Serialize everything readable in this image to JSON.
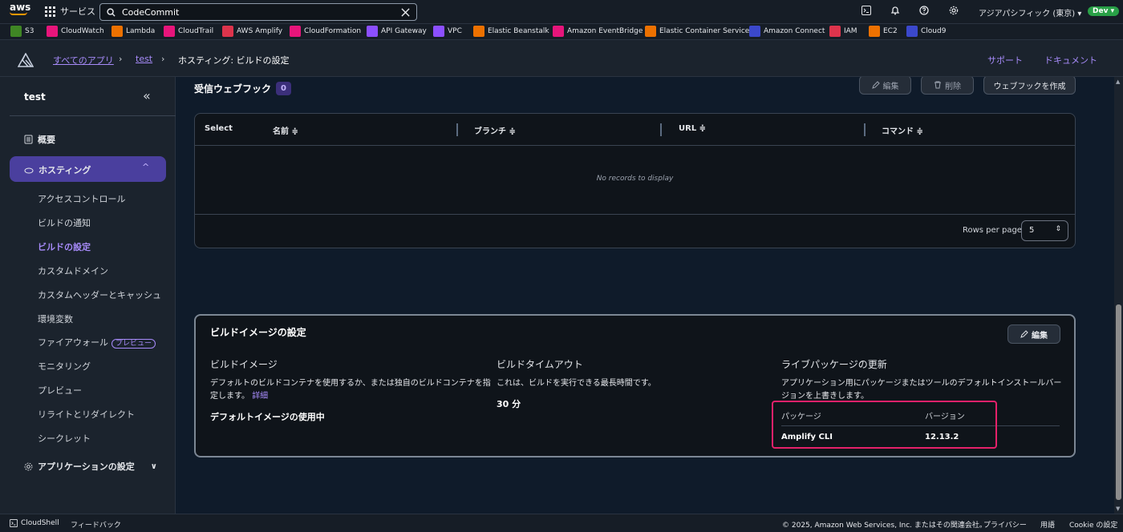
{
  "topbar": {
    "logo": "aws",
    "services": "サービス",
    "search_value": "CodeCommit",
    "region": "アジアパシフィック (東京) ▾",
    "account": "Dev ▾"
  },
  "favorites": [
    {
      "label": "S3",
      "color": "#3f8624"
    },
    {
      "label": "CloudWatch",
      "color": "#e7157b"
    },
    {
      "label": "Lambda",
      "color": "#ed7100"
    },
    {
      "label": "CloudTrail",
      "color": "#e7157b"
    },
    {
      "label": "AWS Amplify",
      "color": "#dd344c"
    },
    {
      "label": "CloudFormation",
      "color": "#e7157b"
    },
    {
      "label": "API Gateway",
      "color": "#8c4fff"
    },
    {
      "label": "VPC",
      "color": "#8c4fff"
    },
    {
      "label": "Elastic Beanstalk",
      "color": "#ed7100"
    },
    {
      "label": "Amazon EventBridge",
      "color": "#e7157b"
    },
    {
      "label": "Elastic Container Service",
      "color": "#ed7100"
    },
    {
      "label": "Amazon Connect",
      "color": "#3b48cc"
    },
    {
      "label": "IAM",
      "color": "#dd344c"
    },
    {
      "label": "EC2",
      "color": "#ed7100"
    },
    {
      "label": "Cloud9",
      "color": "#3b48cc"
    }
  ],
  "appbar": {
    "crumb_all": "すべてのアプリ",
    "crumb_app": "test",
    "crumb_current": "ホスティング: ビルドの設定",
    "support": "サポート",
    "docs": "ドキュメント"
  },
  "sidebar": {
    "title": "test",
    "overview": "概要",
    "hosting": "ホスティング",
    "sub": [
      "アクセスコントロール",
      "ビルドの通知",
      "ビルドの設定",
      "カスタムドメイン",
      "カスタムヘッダーとキャッシュ",
      "環境変数",
      "ファイアウォール",
      "モニタリング",
      "プレビュー",
      "リライトとリダイレクト",
      "シークレット"
    ],
    "preview_badge": "プレビュー",
    "app_settings": "アプリケーションの設定"
  },
  "webhooks": {
    "title": "受信ウェブフック",
    "count": "0",
    "edit": "編集",
    "delete": "削除",
    "create": "ウェブフックを作成",
    "columns": [
      "Select",
      "名前 ≑",
      "ブランチ ≑",
      "URL ≑",
      "コマンド ≑"
    ],
    "empty": "No records to display",
    "rows_per_page_label": "Rows per page",
    "rows_per_page_value": "5"
  },
  "build_image": {
    "title": "ビルドイメージの設定",
    "edit": "編集",
    "image_heading": "ビルドイメージ",
    "image_desc": "デフォルトのビルドコンテナを使用するか、または独自のビルドコンテナを指定します。",
    "image_link": "詳細",
    "image_value": "デフォルトイメージの使用中",
    "timeout_heading": "ビルドタイムアウト",
    "timeout_desc": "これは、ビルドを実行できる最長時間です。",
    "timeout_value": "30 分",
    "live_heading": "ライブパッケージの更新",
    "live_desc": "アプリケーション用にパッケージまたはツールのデフォルトインストールバージョンを上書きします。",
    "pkg_col": "パッケージ",
    "ver_col": "バージョン",
    "pkg_name": "Amplify CLI",
    "pkg_version": "12.13.2"
  },
  "footer": {
    "cloudshell": "CloudShell",
    "feedback": "フィードバック",
    "copyright": "© 2025, Amazon Web Services, Inc. またはその関連会社。",
    "privacy": "プライバシー",
    "terms": "用語",
    "cookie": "Cookie の設定"
  }
}
